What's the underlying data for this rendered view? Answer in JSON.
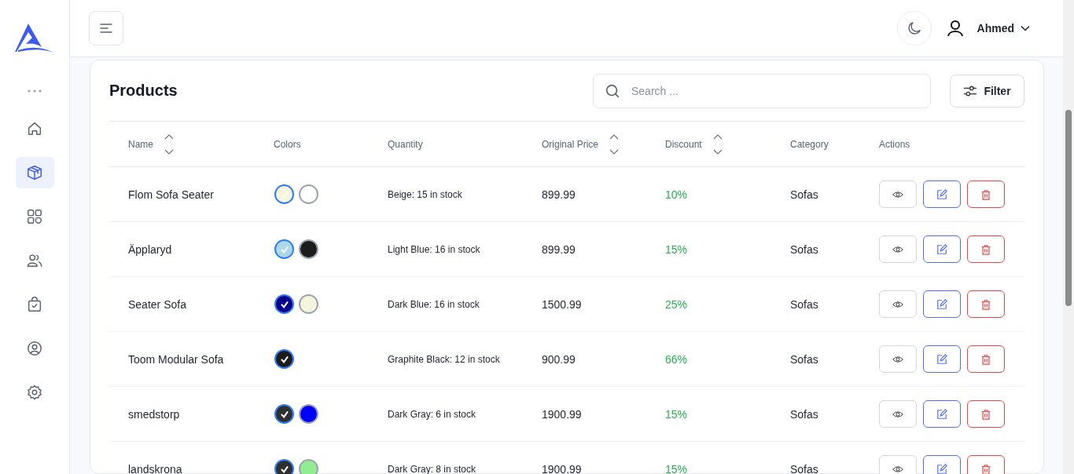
{
  "sidebar": {
    "items": [
      {
        "kind": "home",
        "selected": false
      },
      {
        "kind": "box",
        "selected": true
      },
      {
        "kind": "grid",
        "selected": false
      },
      {
        "kind": "users",
        "selected": false
      },
      {
        "kind": "bag",
        "selected": false
      },
      {
        "kind": "user",
        "selected": false
      },
      {
        "kind": "gear",
        "selected": false
      }
    ]
  },
  "topbar": {
    "user_name": "Ahmed"
  },
  "products": {
    "title": "Products",
    "search": {
      "placeholder": "Search ..."
    },
    "filter_button": "Filter",
    "columns": [
      {
        "label": "Name",
        "sortable": true
      },
      {
        "label": "Colors",
        "sortable": false
      },
      {
        "label": "Quantity",
        "sortable": false
      },
      {
        "label": "Original Price",
        "sortable": true
      },
      {
        "label": "Discount",
        "sortable": true
      },
      {
        "label": "Category",
        "sortable": false
      },
      {
        "label": "Actions",
        "sortable": false
      }
    ],
    "rows": [
      {
        "name": "Flom Sofa Seater",
        "colors": [
          {
            "color": "#f5f5dc",
            "selected": true
          },
          {
            "color": "#ffffff",
            "selected": false
          }
        ],
        "quantity": "Beige: 15 in stock",
        "price": "899.99",
        "discount": "10%",
        "category": "Sofas"
      },
      {
        "name": "Äpplaryd",
        "colors": [
          {
            "color": "#add8e6",
            "selected": true
          },
          {
            "color": "#1c1c1c",
            "selected": false
          }
        ],
        "quantity": "Light Blue: 16 in stock",
        "price": "899.99",
        "discount": "15%",
        "category": "Sofas"
      },
      {
        "name": "Seater Sofa",
        "colors": [
          {
            "color": "#00008b",
            "selected": true
          },
          {
            "color": "#f5f5dc",
            "selected": false
          }
        ],
        "quantity": "Dark Blue: 16 in stock",
        "price": "1500.99",
        "discount": "25%",
        "category": "Sofas"
      },
      {
        "name": "Toom Modular Sofa",
        "colors": [
          {
            "color": "#1c1c1c",
            "selected": true
          }
        ],
        "quantity": "Graphite Black: 12 in stock",
        "price": "900.99",
        "discount": "66%",
        "category": "Sofas"
      },
      {
        "name": "smedstorp",
        "colors": [
          {
            "color": "#2f2f2f",
            "selected": true
          },
          {
            "color": "#0000ff",
            "selected": false
          }
        ],
        "quantity": "Dark Gray: 6 in stock",
        "price": "1900.99",
        "discount": "15%",
        "category": "Sofas"
      },
      {
        "name": "landskrona",
        "colors": [
          {
            "color": "#2f2f2f",
            "selected": true
          },
          {
            "color": "#90ee90",
            "selected": false
          }
        ],
        "quantity": "Dark Gray: 8 in stock",
        "price": "1900.99",
        "discount": "15%",
        "category": "Sofas"
      }
    ]
  }
}
